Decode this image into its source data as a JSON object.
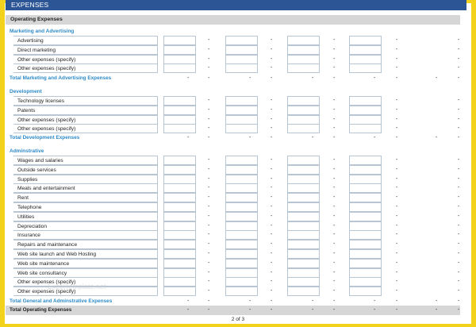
{
  "title": "EXPENSES",
  "subheader": "Operating Expenses",
  "dash": "-",
  "sections": [
    {
      "title": "Marketing and Advertising",
      "items": [
        "Advertising",
        "Direct marketing",
        "Other expenses (specify)",
        "Other expenses (specify)"
      ],
      "total_label": "Total Marketing and Advertising Expenses"
    },
    {
      "title": "Development",
      "items": [
        "Technology licenses",
        "Patents",
        "Other expenses (specify)",
        "Other expenses (specify)"
      ],
      "total_label": "Total Development Expenses"
    },
    {
      "title": "Adminstrative",
      "items": [
        "Wages and salaries",
        "Outside services",
        "Supplies",
        "Meals and entertainment",
        "Rent",
        "Telephone",
        "Utilities",
        "Depreciation",
        "Insurance",
        "Repairs and maintenance",
        "Web site launch and Web Hosting",
        "Web site maintenance",
        "Web site consultancy",
        "Other expenses (specify)",
        "Other expenses (specify)"
      ],
      "total_label": "Total General and Adminstrative Expenses"
    }
  ],
  "grand_total_label": "Total Operating Expenses",
  "watermark": "ExcelTemplate.net",
  "page_footer": "2 of 3"
}
